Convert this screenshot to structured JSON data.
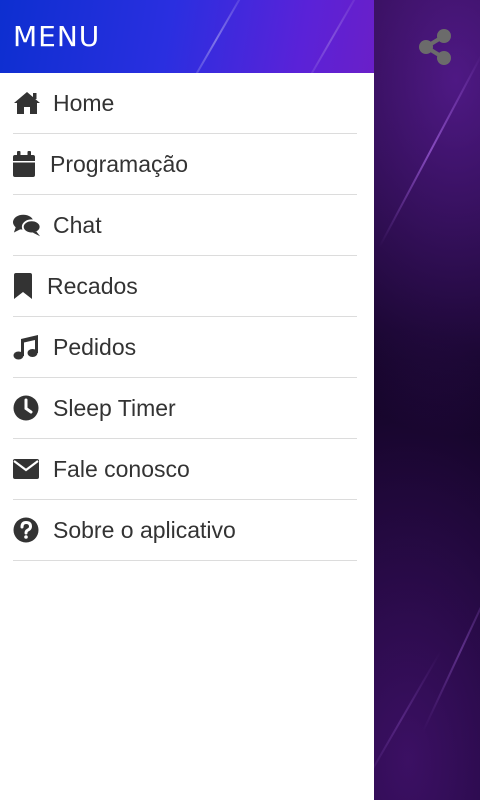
{
  "drawer": {
    "title": "MENU",
    "items": [
      {
        "label": "Home",
        "icon": "home-icon"
      },
      {
        "label": "Programação",
        "icon": "calendar-icon"
      },
      {
        "label": "Chat",
        "icon": "chat-icon"
      },
      {
        "label": "Recados",
        "icon": "bookmark-icon"
      },
      {
        "label": "Pedidos",
        "icon": "music-icon"
      },
      {
        "label": "Sleep Timer",
        "icon": "clock-icon"
      },
      {
        "label": "Fale conosco",
        "icon": "envelope-icon"
      },
      {
        "label": "Sobre o aplicativo",
        "icon": "question-icon"
      }
    ]
  },
  "colors": {
    "header_start": "#0d2fd0",
    "header_end": "#6a1fc8",
    "icon": "#333333",
    "divider": "#dcdcdc",
    "background": "#14041f",
    "share_icon": "#6b6b6b"
  },
  "actions": {
    "share_icon": "share-icon"
  }
}
